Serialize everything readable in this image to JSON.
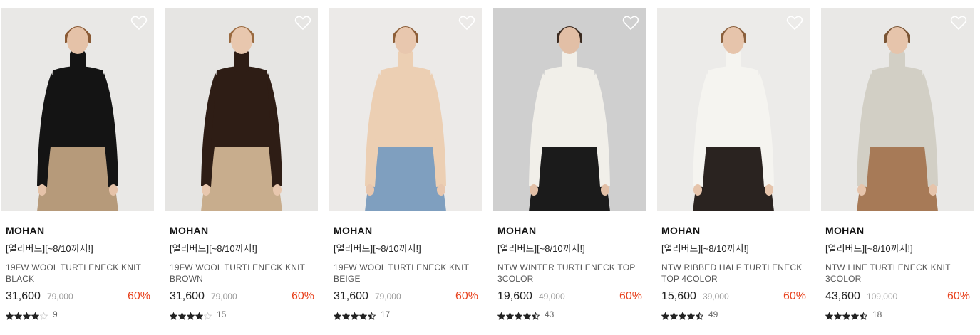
{
  "products": [
    {
      "brand": "MOHAN",
      "promo": "[얼리버드][~8/10까지!]",
      "name": "19FW WOOL TURTLENECK KNIT BLACK",
      "price": "31,600",
      "original_price": "79,000",
      "discount": "60%",
      "rating": 4,
      "reviews": "9",
      "photo": {
        "bg": "#e9e8e6",
        "top": "#141414",
        "bottom": "#b69a7a",
        "skin": "#e5c2a8",
        "hair": "#8a5a35"
      }
    },
    {
      "brand": "MOHAN",
      "promo": "[얼리버드][~8/10까지!]",
      "name": "19FW WOOL TURTLENECK KNIT BROWN",
      "price": "31,600",
      "original_price": "79,000",
      "discount": "60%",
      "rating": 4,
      "reviews": "15",
      "photo": {
        "bg": "#e6e5e3",
        "top": "#2e1d15",
        "bottom": "#c8ad8d",
        "skin": "#e8c7ae",
        "hair": "#9a6a40"
      }
    },
    {
      "brand": "MOHAN",
      "promo": "[얼리버드][~8/10까지!]",
      "name": "19FW WOOL TURTLENECK KNIT BEIGE",
      "price": "31,600",
      "original_price": "79,000",
      "discount": "60%",
      "rating": 4.5,
      "reviews": "17",
      "photo": {
        "bg": "#eceae8",
        "top": "#eccfb3",
        "bottom": "#7f9fbf",
        "skin": "#e8c7ae",
        "hair": "#8d5e38"
      }
    },
    {
      "brand": "MOHAN",
      "promo": "[얼리버드][~8/10까지!]",
      "name": "NTW WINTER TURTLENECK TOP 3COLOR",
      "price": "19,600",
      "original_price": "49,000",
      "discount": "60%",
      "rating": 4.5,
      "reviews": "43",
      "photo": {
        "bg": "#cfcfcf",
        "top": "#f1efe9",
        "bottom": "#1b1b1b",
        "skin": "#e2bfa6",
        "hair": "#3a2a20"
      }
    },
    {
      "brand": "MOHAN",
      "promo": "[얼리버드][~8/10까지!]",
      "name": "NTW RIBBED HALF TURTLENECK TOP 4COLOR",
      "price": "15,600",
      "original_price": "39,000",
      "discount": "60%",
      "rating": 4.5,
      "reviews": "49",
      "photo": {
        "bg": "#ecebe9",
        "top": "#f5f4f0",
        "bottom": "#2a2320",
        "skin": "#e6c4ab",
        "hair": "#8a5f3c"
      }
    },
    {
      "brand": "MOHAN",
      "promo": "[얼리버드][~8/10까지!]",
      "name": "NTW LINE TURTLENECK KNIT 3COLOR",
      "price": "43,600",
      "original_price": "109,000",
      "discount": "60%",
      "rating": 4.5,
      "reviews": "18",
      "photo": {
        "bg": "#e9e8e6",
        "top": "#d2cfc5",
        "bottom": "#a77a57",
        "skin": "#e6c4ab",
        "hair": "#7a5535"
      }
    }
  ],
  "colors": {
    "discount": "#e8431f",
    "star": "#222222",
    "star_empty": "#cccccc"
  },
  "icons": {
    "wishlist": "heart-outline-icon",
    "rating": "star-icon"
  }
}
